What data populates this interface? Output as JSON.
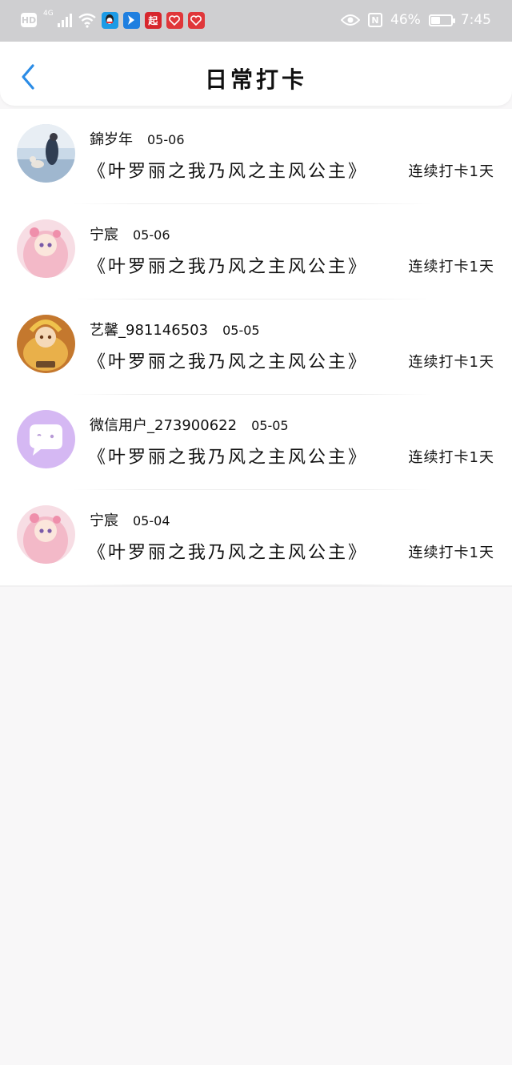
{
  "status_bar": {
    "network": "4G",
    "battery_percent": "46%",
    "battery_level": 0.46,
    "time": "7:45",
    "app_badge": "起"
  },
  "header": {
    "title": "日常打卡",
    "back_icon": "chevron-left-icon"
  },
  "colors": {
    "accent_blue": "#2b8ce6",
    "status_bar_bg": "#cfcfd1",
    "page_bg": "#f8f7f8"
  },
  "checkins": [
    {
      "user": "錦岁年",
      "date": "05-06",
      "book": "《叶罗丽之我乃风之主风公主》",
      "streak": "连续打卡1天",
      "avatar": "photo-avatar"
    },
    {
      "user": "宁宸",
      "date": "05-06",
      "book": "《叶罗丽之我乃风之主风公主》",
      "streak": "连续打卡1天",
      "avatar": "pink-doll-avatar"
    },
    {
      "user": "艺馨_981146503",
      "date": "05-05",
      "book": "《叶罗丽之我乃风之主风公主》",
      "streak": "连续打卡1天",
      "avatar": "gold-doll-avatar"
    },
    {
      "user": "微信用户_273900622",
      "date": "05-05",
      "book": "《叶罗丽之我乃风之主风公主》",
      "streak": "连续打卡1天",
      "avatar": "default-chat-avatar"
    },
    {
      "user": "宁宸",
      "date": "05-04",
      "book": "《叶罗丽之我乃风之主风公主》",
      "streak": "连续打卡1天",
      "avatar": "pink-doll-avatar"
    }
  ]
}
